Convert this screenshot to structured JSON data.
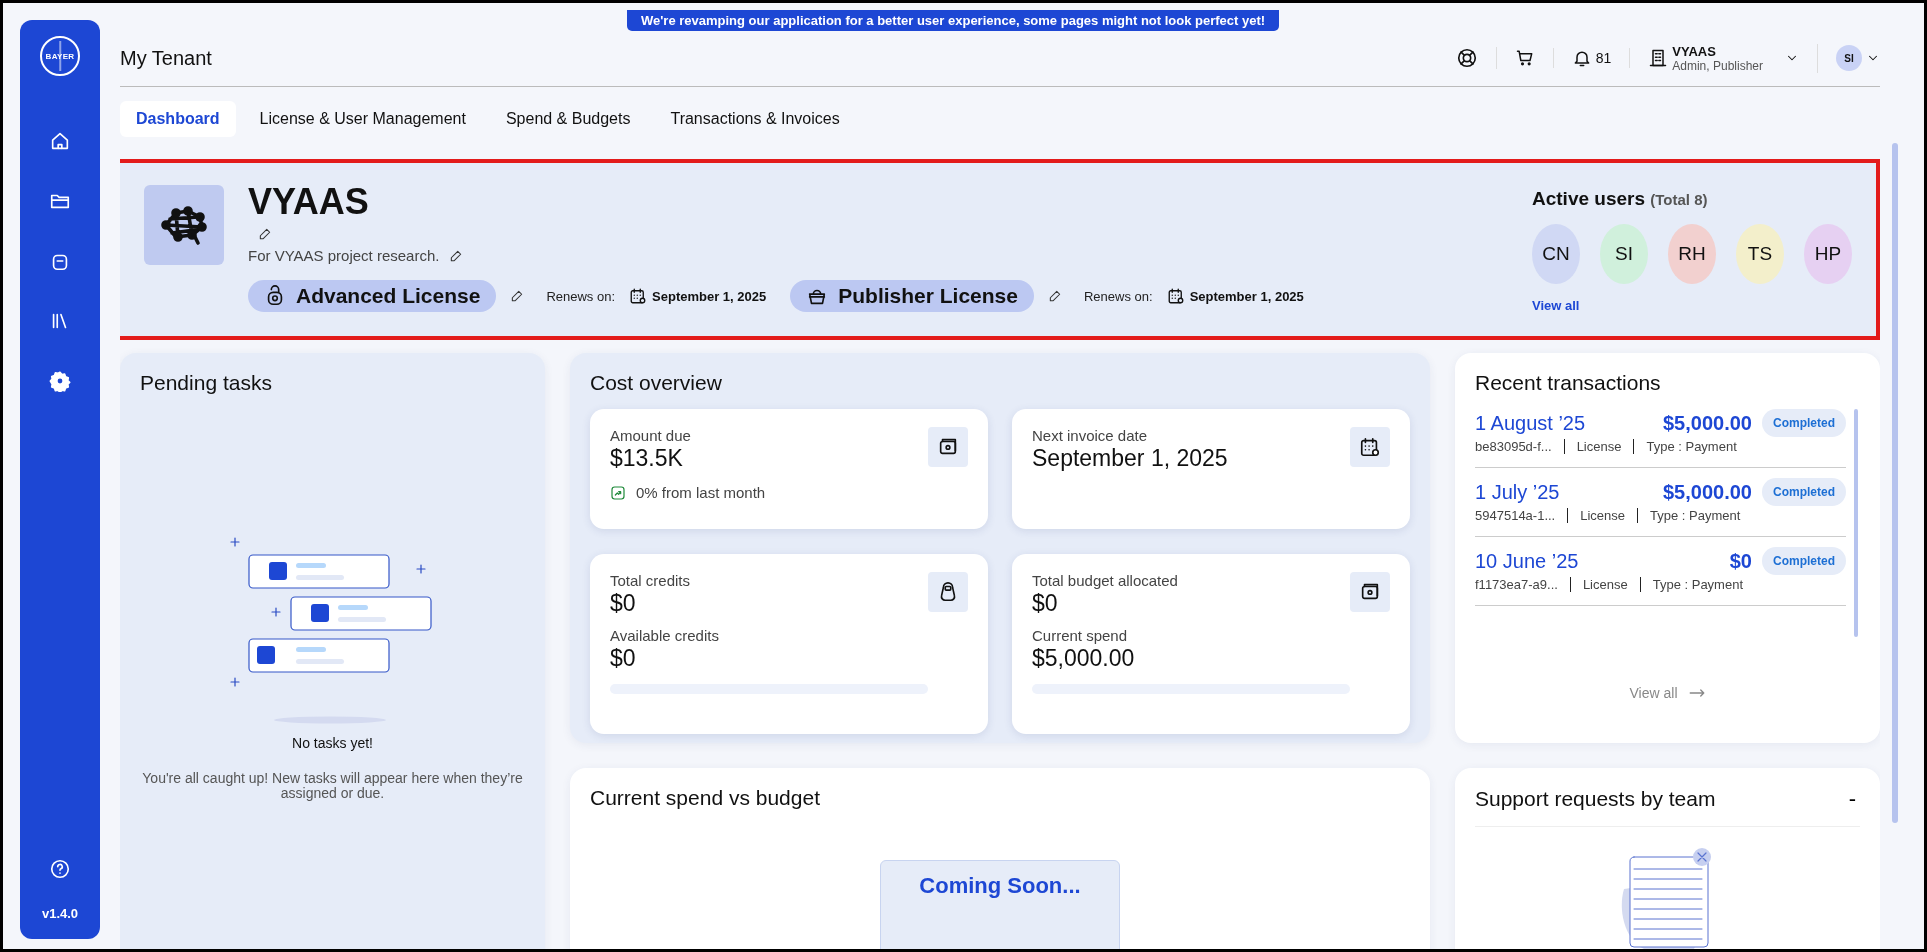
{
  "notice": "We're revamping our application for a better user experience, some pages might not look perfect yet!",
  "sidebar": {
    "logo": "BAYER",
    "nav": [
      {
        "kind": "home"
      },
      {
        "kind": "folder"
      },
      {
        "kind": "bag"
      },
      {
        "kind": "library"
      },
      {
        "kind": "settings"
      }
    ],
    "version": "v1.4.0"
  },
  "header": {
    "title": "My Tenant",
    "notifications": "81",
    "account_name": "VYAAS",
    "account_role": "Admin, Publisher",
    "avatar": "SI"
  },
  "tabs": [
    {
      "label": "Dashboard",
      "selected": true
    },
    {
      "label": "License & User Management",
      "selected": false
    },
    {
      "label": "Spend & Budgets",
      "selected": false
    },
    {
      "label": "Transactions & Invoices",
      "selected": false
    }
  ],
  "project": {
    "name": "VYAAS",
    "description": "For VYAAS project research.",
    "licenses": [
      {
        "kind": "advanced",
        "label": "Advanced License",
        "renews_label": "Renews on:",
        "renews_date": "September 1, 2025"
      },
      {
        "kind": "publisher",
        "label": "Publisher License",
        "renews_label": "Renews on:",
        "renews_date": "September 1, 2025"
      }
    ],
    "active_users": {
      "title": "Active users",
      "total": "(Total 8)",
      "view_all": "View all",
      "users": [
        {
          "initials": "CN",
          "color": "#d0d8f4"
        },
        {
          "initials": "SI",
          "color": "#d0f0dc"
        },
        {
          "initials": "RH",
          "color": "#f2d0cf"
        },
        {
          "initials": "TS",
          "color": "#f3efcb"
        },
        {
          "initials": "HP",
          "color": "#e6d0f2"
        }
      ]
    }
  },
  "pending_tasks": {
    "title": "Pending tasks",
    "empty_title": "No tasks yet!",
    "empty_text": "You're all caught up! New tasks will appear here when they’re assigned or due."
  },
  "cost_overview": {
    "title": "Cost overview",
    "cards": [
      {
        "kind": "money",
        "label": "Amount due",
        "value": "$13.5K",
        "trend": "0% from last month"
      },
      {
        "kind": "calendar",
        "label": "Next invoice date",
        "value": "September 1, 2025"
      },
      {
        "kind": "bag",
        "label": "Total credits",
        "value": "$0",
        "sub_label": "Available credits",
        "sub_value": "$0",
        "level": 0
      },
      {
        "kind": "money",
        "label": "Total budget allocated",
        "value": "$0",
        "sub_label": "Current spend",
        "sub_value": "$5,000.00",
        "level": 0
      }
    ]
  },
  "recent_transactions": {
    "title": "Recent transactions",
    "view_all": "View all",
    "rows": [
      {
        "date": "1 August ’25",
        "amount": "$5,000.00",
        "status": "Completed",
        "id": "be83095d-f...",
        "category": "License",
        "type": "Type : Payment"
      },
      {
        "date": "1 July ’25",
        "amount": "$5,000.00",
        "status": "Completed",
        "id": "5947514a-1...",
        "category": "License",
        "type": "Type : Payment"
      },
      {
        "date": "10 June ’25",
        "amount": "$0",
        "status": "Completed",
        "id": "f1173ea7-a9...",
        "category": "License",
        "type": "Type : Payment"
      }
    ]
  },
  "current_spend": {
    "title": "Current spend vs budget",
    "coming_soon": "Coming Soon..."
  },
  "support_requests": {
    "title": "Support requests by team",
    "menu": "-"
  }
}
